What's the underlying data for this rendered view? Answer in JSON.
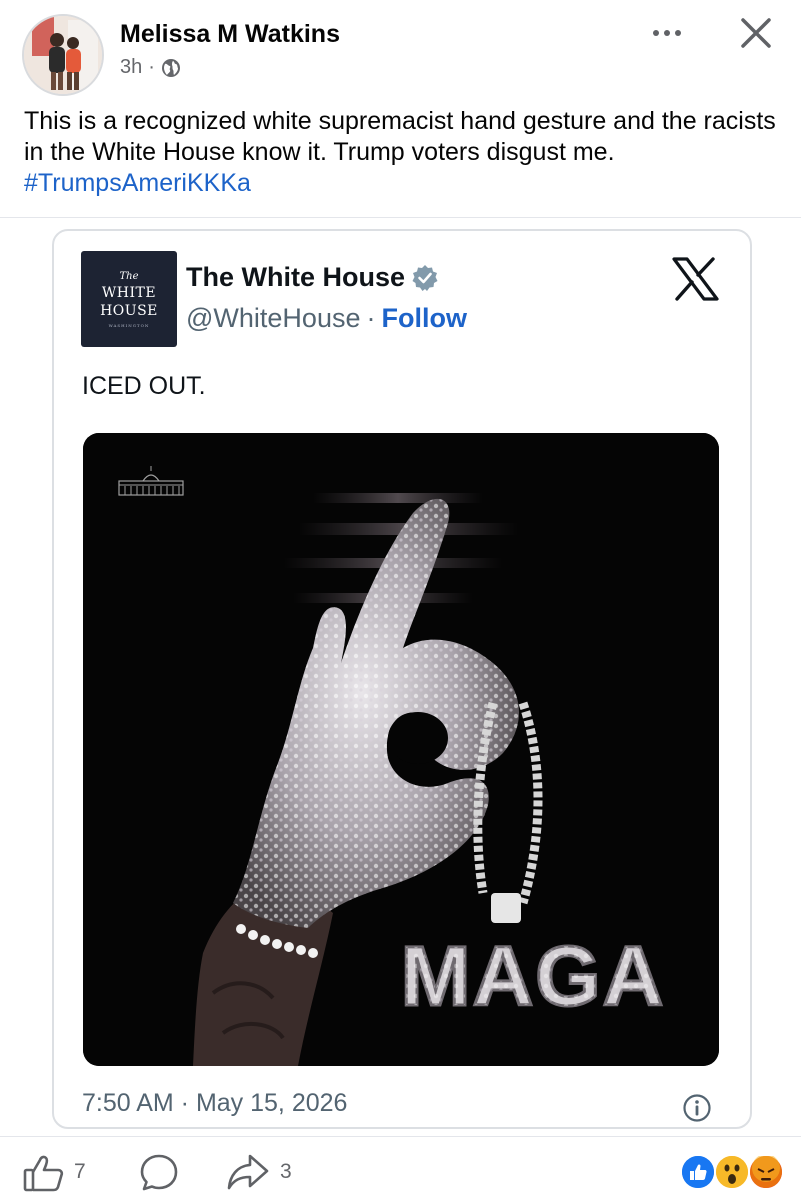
{
  "post": {
    "author": "Melissa M Watkins",
    "time": "3h",
    "separator": "·",
    "text": "This is a recognized white supremacist hand gesture and the racists in the White House know it. Trump voters disgust me.",
    "hashtag": "#TrumpsAmeriKKKa"
  },
  "embed": {
    "logo": {
      "the": "The",
      "line1": "WHITE",
      "line2": "HOUSE",
      "sub": "WASHINGTON"
    },
    "name": "The White House",
    "handle": "@WhiteHouse",
    "separator": "·",
    "follow_label": "Follow",
    "text": "ICED OUT.",
    "media_text": "MAGA",
    "timestamp": "7:50 AM · May 15, 2026"
  },
  "actions": {
    "like_count": "7",
    "share_count": "3"
  },
  "icons": {
    "more": "more-horizontal-icon",
    "close": "close-icon",
    "globe": "globe-icon",
    "verified": "verified-badge-icon",
    "x": "x-logo-icon",
    "info": "info-icon",
    "like": "thumbs-up-icon",
    "comment": "comment-icon",
    "share": "share-icon"
  },
  "colors": {
    "link": "#1d63c9",
    "secondary": "#65676b",
    "like_reaction": "#1877f2",
    "wow_reaction": "#f7b928",
    "angry_reaction": "#e9710f",
    "verified": "#829aab"
  }
}
